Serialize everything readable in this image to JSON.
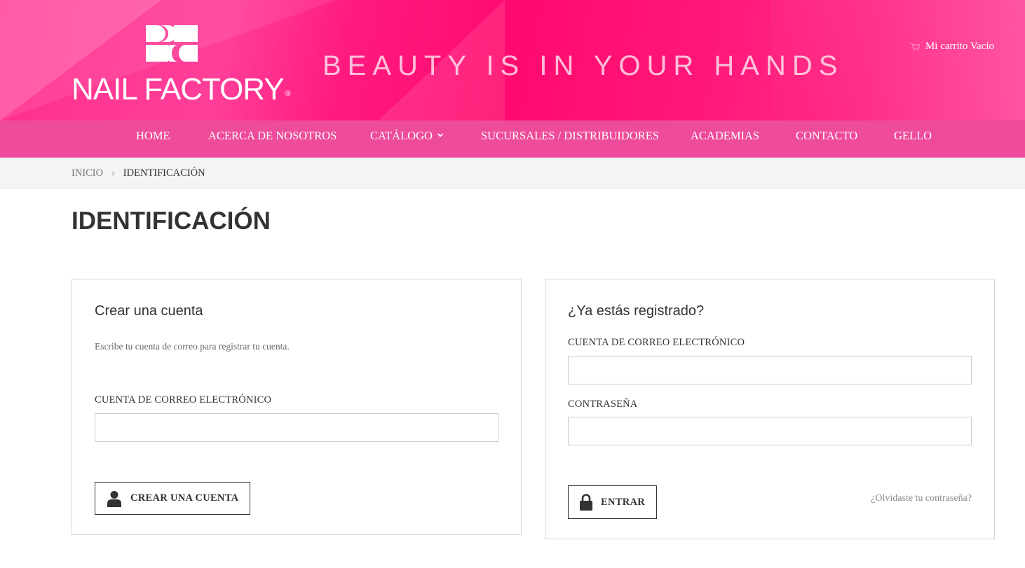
{
  "header": {
    "logo_text": "NAIL FACTORY",
    "logo_reg": "®",
    "tagline": "BEAUTY IS IN YOUR HANDS",
    "cart_label": "Mi carrito Vacío",
    "cart_icon": "cart-icon"
  },
  "nav": {
    "items": [
      {
        "label": "HOME"
      },
      {
        "label": "ACERCA DE NOSOTROS"
      },
      {
        "label": "CATÁLOGO",
        "icon": "chevron-down-icon"
      },
      {
        "label": "SUCURSALES / DISTRIBUIDORES"
      },
      {
        "label": "ACADEMIAS"
      },
      {
        "label": "CONTACTO"
      },
      {
        "label": "GELLO"
      }
    ]
  },
  "breadcrumb": {
    "home": "INICIO",
    "separator": "›",
    "current": "IDENTIFICACIÓN"
  },
  "page": {
    "title": "IDENTIFICACIÓN"
  },
  "create_account": {
    "heading": "Crear una cuenta",
    "description": "Escribe tu cuenta de correo para registrar tu cuenta.",
    "email_label": "CUENTA DE CORREO ELECTRÓNICO",
    "email_value": "",
    "button_label": "CREAR UNA CUENTA",
    "button_icon": "user-icon"
  },
  "login": {
    "heading": "¿Ya estás registrado?",
    "email_label": "CUENTA DE CORREO ELECTRÓNICO",
    "email_value": "",
    "password_label": "CONTRASEÑA",
    "password_value": "",
    "button_label": "ENTRAR",
    "button_icon": "lock-icon",
    "forgot_link": "¿Olvidaste tu contraseña?"
  },
  "colors": {
    "brand_pink": "#ff1a7f",
    "nav_pink": "#ee4b9a",
    "breadcrumb_bg": "#f4f4f4",
    "text_dark": "#333333"
  }
}
